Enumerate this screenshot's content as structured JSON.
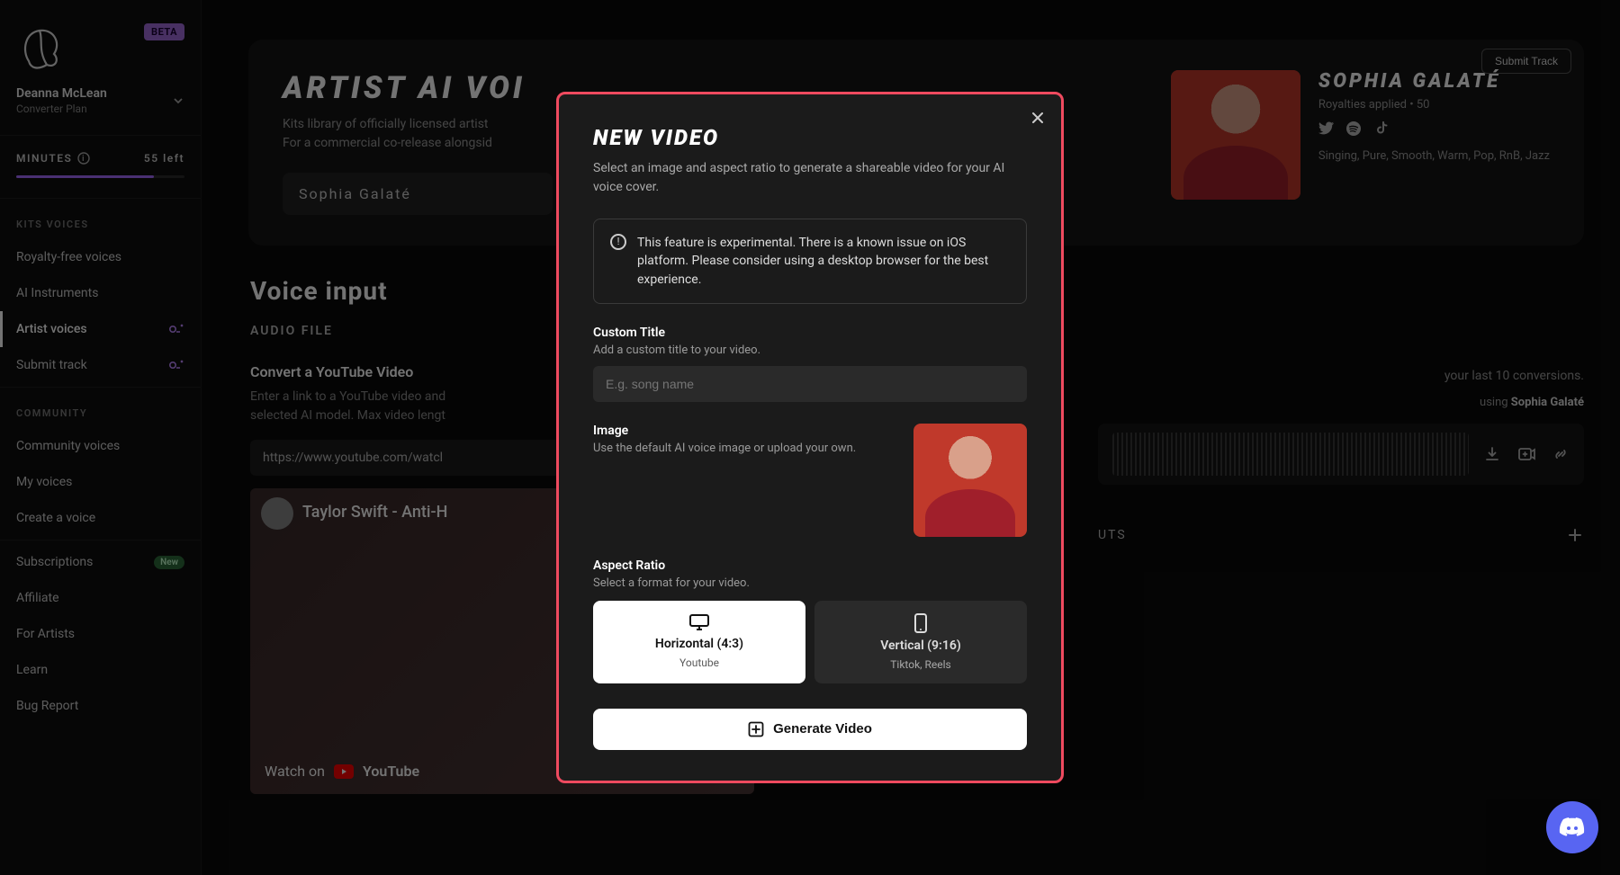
{
  "sidebar": {
    "beta": "BETA",
    "user_name": "Deanna McLean",
    "user_plan": "Converter Plan",
    "minutes_label": "MINUTES",
    "minutes_left": "55 left",
    "section_kits": "KITS VOICES",
    "section_community": "COMMUNITY",
    "items": {
      "royalty_free": "Royalty-free voices",
      "ai_instruments": "AI Instruments",
      "artist_voices": "Artist voices",
      "submit_track": "Submit track",
      "community_voices": "Community voices",
      "my_voices": "My voices",
      "create_voice": "Create a voice",
      "subscriptions": "Subscriptions",
      "affiliate": "Affiliate",
      "for_artists": "For Artists",
      "learn": "Learn",
      "bug_report": "Bug Report"
    },
    "new_badge": "New"
  },
  "hero": {
    "title": "ARTIST AI VOI",
    "desc1": "Kits library of officially licensed artist",
    "desc2": "For a commercial co-release alongsid",
    "search_value": "Sophia Galaté"
  },
  "artist": {
    "name": "SOPHIA GALATÉ",
    "royalties": "Royalties applied • 50",
    "tags": "Singing, Pure, Smooth, Warm, Pop, RnB, Jazz",
    "submit_btn": "Submit Track"
  },
  "voice": {
    "title": "Voice input",
    "tab_audio": "AUDIO FILE",
    "convert_head": "Convert a YouTube Video",
    "convert_desc1": "Enter a link to a YouTube video and",
    "convert_desc2": "selected AI model. Max video lengt",
    "url": "https://www.youtube.com/watcl",
    "yt_title": "Taylor Swift - Anti-H",
    "yt_watch": "Watch on",
    "yt_logo": "YouTube"
  },
  "right": {
    "conv_hint_suffix": "your last 10 conversions.",
    "using_prefix": "using ",
    "using_artist": "Sophia Galaté",
    "slots_label": "UTS"
  },
  "modal": {
    "title": "NEW VIDEO",
    "sub": "Select an image and aspect ratio to generate a shareable video for your AI voice cover.",
    "warning": "This feature is experimental. There is a known issue on iOS platform. Please consider using a desktop browser for the best experience.",
    "custom_title_label": "Custom Title",
    "custom_title_help": "Add a custom title to your video.",
    "custom_title_placeholder": "E.g. song name",
    "image_label": "Image",
    "image_help": "Use the default AI voice image or upload your own.",
    "aspect_label": "Aspect Ratio",
    "aspect_help": "Select a format for your video.",
    "aspect_h_name": "Horizontal (4:3)",
    "aspect_h_hint": "Youtube",
    "aspect_v_name": "Vertical (9:16)",
    "aspect_v_hint": "Tiktok, Reels",
    "generate_btn": "Generate Video"
  }
}
